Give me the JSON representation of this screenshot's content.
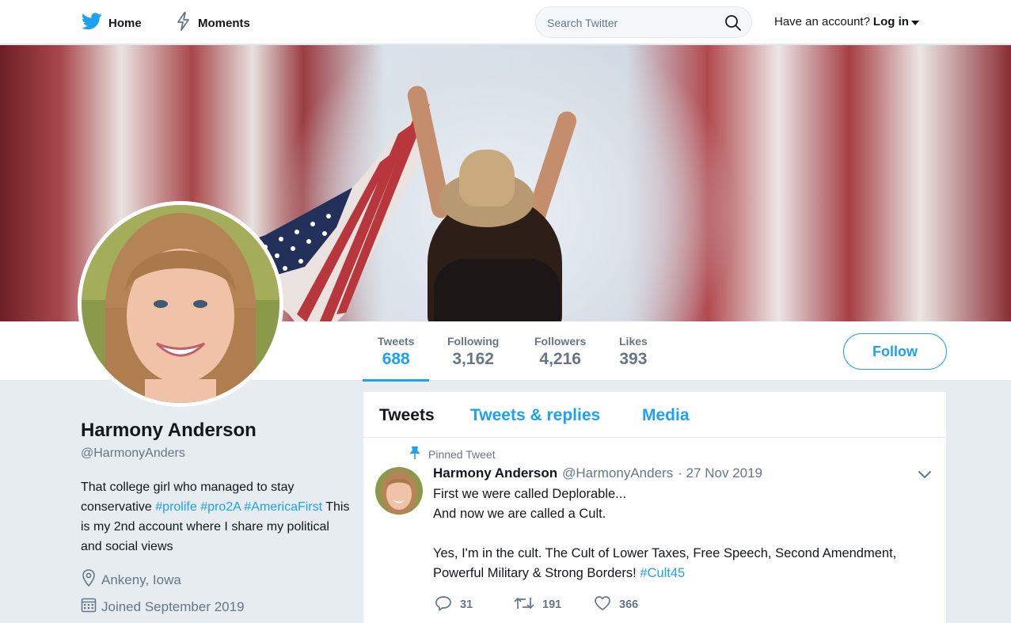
{
  "nav": {
    "home_label": "Home",
    "moments_label": "Moments",
    "search_placeholder": "Search Twitter",
    "account_prompt": "Have an account?",
    "login_label": "Log in"
  },
  "profile": {
    "name": "Harmony Anderson",
    "handle": "@HarmonyAnders",
    "bio_text_1": "That college girl who managed to stay conservative",
    "bio_tag_1": "#prolife",
    "bio_tag_2": "#pro2A",
    "bio_tag_3": "#AmericaFirst",
    "bio_text_2": "This is my 2nd account where I share my political and social views",
    "location": "Ankeny, Iowa",
    "joined": "Joined September 2019"
  },
  "stats": {
    "tweets": {
      "label": "Tweets",
      "value": "688"
    },
    "following": {
      "label": "Following",
      "value": "3,162"
    },
    "followers": {
      "label": "Followers",
      "value": "4,216"
    },
    "likes": {
      "label": "Likes",
      "value": "393"
    }
  },
  "follow_label": "Follow",
  "timeline": {
    "tabs": [
      {
        "label": "Tweets",
        "active": true
      },
      {
        "label": "Tweets & replies",
        "active": false
      },
      {
        "label": "Media",
        "active": false
      }
    ],
    "pinned_label": "Pinned Tweet",
    "tweet": {
      "author_name": "Harmony Anderson",
      "author_handle": "@HarmonyAnders",
      "date": "· 27 Nov 2019",
      "line_1": "First we were called Deplorable...",
      "line_2": "And now we are called a Cult.",
      "line_3": "Yes, I'm in the cult. The Cult of Lower Taxes, Free Speech, Second Amendment, Powerful Military & Strong Borders!",
      "hashtag": "#Cult45",
      "replies": "31",
      "retweets": "191",
      "likes": "366"
    }
  },
  "colors": {
    "accent": "#1da1f2",
    "muted": "#657786",
    "page_bg": "#e6ecf0"
  }
}
